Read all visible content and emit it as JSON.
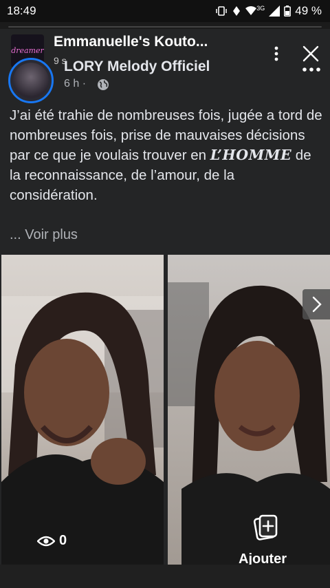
{
  "status_bar": {
    "time": "18:49",
    "network": "3G",
    "battery": "49 %"
  },
  "story": {
    "logo_text": "dreamer",
    "title": "Emmanuelle's Kouto...",
    "time": "9 s"
  },
  "post": {
    "author": "LORY Melody Officiel",
    "time": "6 h ·",
    "text_before": "J’ai été trahie de nombreuses fois, jugée a tord de nombreuses fois, prise de mauvaises décisions par ce que je voulais trouver en ",
    "text_emphasis": "L’HOMME",
    "text_after": " de la reconnaissance, de l’amour, de la considération.",
    "see_more": "... Voir plus"
  },
  "footer": {
    "views_count": "0",
    "add_label": "Ajouter"
  },
  "icons": [
    "vibrate-icon",
    "alarm-icon",
    "wifi-icon",
    "signal-icon",
    "battery-icon",
    "globe-icon",
    "menu-icon",
    "close-icon",
    "more-icon",
    "next-icon",
    "eye-icon",
    "add-icon"
  ],
  "colors": {
    "story_ring": "#1877f2",
    "background": "#242526"
  }
}
